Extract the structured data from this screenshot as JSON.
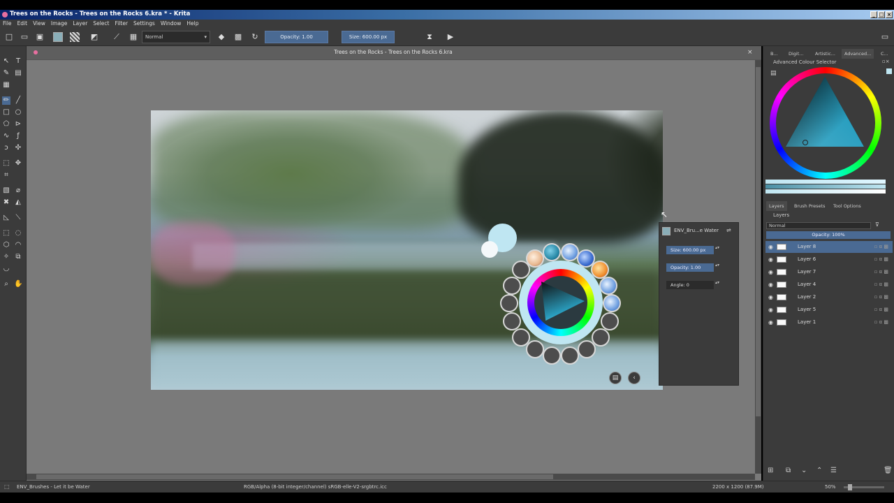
{
  "window": {
    "title": "Trees on the Rocks - Trees on the Rocks 6.kra * - Krita",
    "controls": [
      "_",
      "□",
      "×"
    ]
  },
  "menu": [
    "File",
    "Edit",
    "View",
    "Image",
    "Layer",
    "Select",
    "Filter",
    "Settings",
    "Window",
    "Help"
  ],
  "toolbar": {
    "blend_mode": "Normal",
    "opacity_label": "Opacity: 1.00",
    "size_label": "Size: 600.00 px"
  },
  "document": {
    "tab_title": "Trees on the Rocks - Trees on the Rocks 6.kra"
  },
  "brush_panel": {
    "preset_name": "ENV_Bru...e Water",
    "size": "Size: 600.00 px",
    "opacity": "Opacity: 1.00",
    "angle": "Angle: 0"
  },
  "docker": {
    "top_tabs": [
      "B...",
      "Digit...",
      "Artistic...",
      "Advanced...",
      "C..."
    ],
    "colour_selector_title": "Advanced Colour Selector",
    "bottom_tabs": [
      "Layers",
      "Brush Presets",
      "Tool Options"
    ],
    "layers_title": "Layers",
    "layers_blend": "Normal",
    "layers_opacity": "Opacity: 100%",
    "layers": [
      {
        "name": "Layer 8",
        "selected": true
      },
      {
        "name": "Layer 6",
        "selected": false
      },
      {
        "name": "Layer 7",
        "selected": false
      },
      {
        "name": "Layer 4",
        "selected": false
      },
      {
        "name": "Layer 2",
        "selected": false
      },
      {
        "name": "Layer 5",
        "selected": false
      },
      {
        "name": "Layer 1",
        "selected": false
      }
    ]
  },
  "status": {
    "brush": "ENV_Brushes - Let it be Water",
    "color_profile": "RGB/Alpha (8-bit integer/channel) sRGB-elle-V2-srgbtrc.icc",
    "dimensions": "2200 x 1200 (87.9M)",
    "zoom": "50%"
  },
  "colors": {
    "accent": "#4a6a93",
    "panel": "#3b3b3b",
    "canvas_bg": "#7a7a7a",
    "fg_color": "#bfe6f2"
  }
}
